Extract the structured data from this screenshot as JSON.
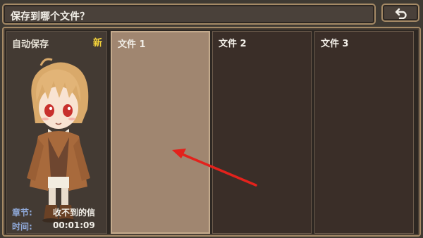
{
  "header": {
    "title": "保存到哪个文件？",
    "back_icon": "back-arrow-icon"
  },
  "autosave": {
    "label": "自动保存",
    "badge": "新",
    "chapter_label": "章节:",
    "chapter_value": "收不到的信",
    "time_label": "时间:",
    "time_value": "00:01:09"
  },
  "slots": [
    {
      "label": "文件 1",
      "selected": true
    },
    {
      "label": "文件 2",
      "selected": false
    },
    {
      "label": "文件 3",
      "selected": false
    }
  ],
  "colors": {
    "accent_border": "#a58a66",
    "badge": "#f3d23a",
    "info_label": "#8fa8d8",
    "selected_slot": "#a08670",
    "annotation_arrow": "#e3221c"
  }
}
